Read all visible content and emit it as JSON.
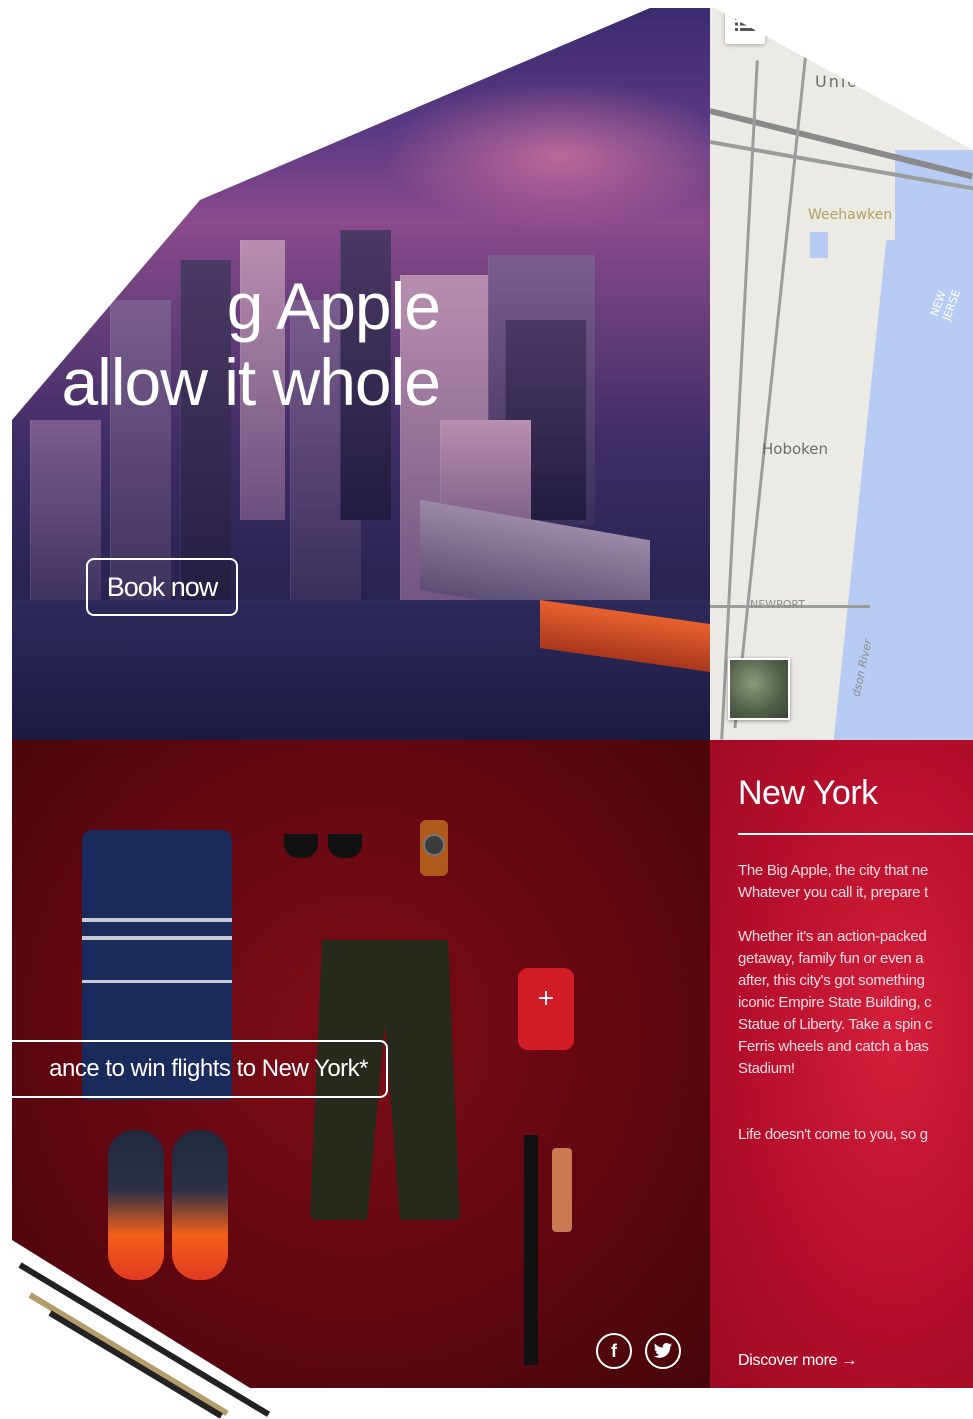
{
  "hero": {
    "title": "g Apple\nallow it whole",
    "book_label": "Book now"
  },
  "map": {
    "labels": {
      "union": "Unio",
      "weehawken": "Weehawken",
      "hoboken": "Hoboken",
      "newport": "NEWPORT",
      "hudson_river": "dson River",
      "new_jersey": "NEW JERSE"
    },
    "menu_icon": "list-icon",
    "satellite_icon": "satellite-thumbnail"
  },
  "promo": {
    "win_label": "ance to win flights to New York*"
  },
  "social": {
    "facebook": "f",
    "twitter": "t"
  },
  "info": {
    "title": "New York",
    "paragraph1": "The Big Apple, the city that ne\nWhatever you call it, prepare t",
    "paragraph2": "Whether it's an action-packed\ngetaway, family fun or even a\nafter, this city's got something\niconic Empire State Building, c\nStatue of Liberty. Take a spin c\nFerris wheels and catch a bas\nStadium!",
    "paragraph3": "Life doesn't come to you, so g",
    "discover_label": "Discover more →"
  },
  "colors": {
    "accent_red": "#c8102e",
    "dark_red": "#5e0710",
    "hero_purple": "#5b3a82",
    "map_water": "#b7cbf3"
  }
}
